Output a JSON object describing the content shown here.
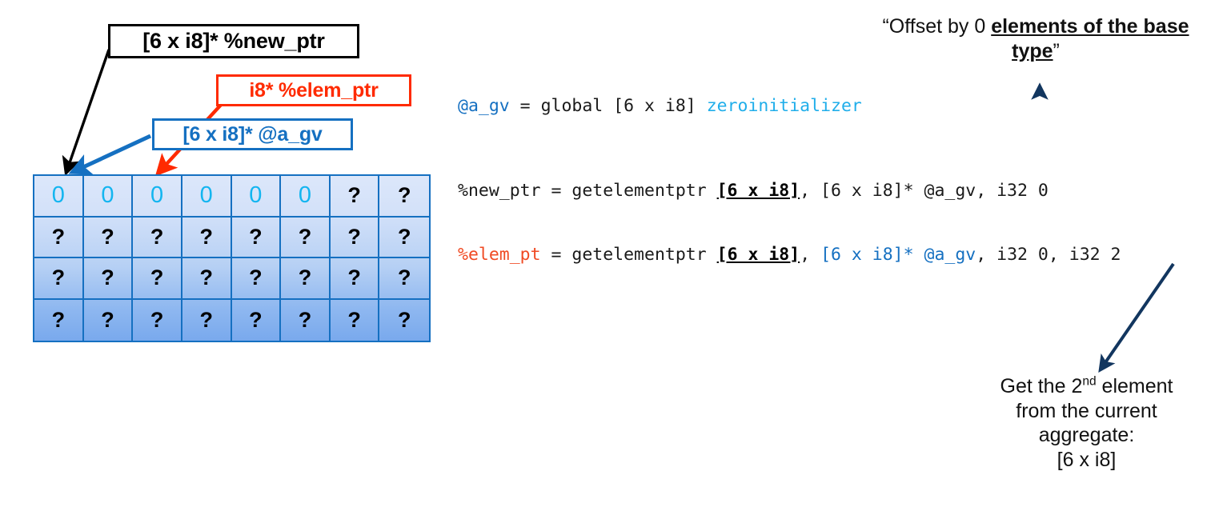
{
  "labels": {
    "new_ptr": "[6 x i8]* %new_ptr",
    "elem_ptr": "i8* %elem_ptr",
    "a_gv": "[6 x i8]* @a_gv"
  },
  "grid": {
    "columns": 8,
    "rows": 4,
    "cells": [
      [
        "0",
        "0",
        "0",
        "0",
        "0",
        "0",
        "?",
        "?"
      ],
      [
        "?",
        "?",
        "?",
        "?",
        "?",
        "?",
        "?",
        "?"
      ],
      [
        "?",
        "?",
        "?",
        "?",
        "?",
        "?",
        "?",
        "?"
      ],
      [
        "?",
        "?",
        "?",
        "?",
        "?",
        "?",
        "?",
        "?"
      ]
    ],
    "zero_color": "#13B5F0",
    "border_color": "#1570C1"
  },
  "code": {
    "line1": {
      "parts": [
        {
          "text": "@a_gv",
          "style": "blue"
        },
        {
          "text": " = global [6 x i8] ",
          "style": "black"
        },
        {
          "text": "zeroinitializer",
          "style": "cyan"
        }
      ]
    },
    "line2": {
      "parts": [
        {
          "text": "%new_ptr = getelementptr ",
          "style": "black"
        },
        {
          "text": "[6 x i8]",
          "style": "bold-underline"
        },
        {
          "text": ", [6 x i8]* @a_gv, i32 0",
          "style": "black"
        }
      ]
    },
    "line3": {
      "parts": [
        {
          "text": "%elem_pt",
          "style": "red"
        },
        {
          "text": " = getelementptr ",
          "style": "black"
        },
        {
          "text": "[6 x i8]",
          "style": "bold-underline"
        },
        {
          "text": ", ",
          "style": "black"
        },
        {
          "text": "[6 x i8]* @a_gv",
          "style": "blue"
        },
        {
          "text": ", i32 0, i32 2",
          "style": "black"
        }
      ]
    }
  },
  "notes": {
    "offset": {
      "prefix": "“Offset by 0 ",
      "emphasis": "elements of the base type",
      "suffix": "”"
    },
    "getelem": {
      "line1_pre": "Get the 2",
      "line1_sup": "nd",
      "line1_post": " element",
      "line2": "from the current",
      "line3": "aggregate:",
      "line4": "[6 x i8]"
    }
  },
  "arrows": {
    "black_color": "#000000",
    "red_color": "#FF2A00",
    "blue_color": "#1570C1",
    "navy_color": "#12365F"
  }
}
